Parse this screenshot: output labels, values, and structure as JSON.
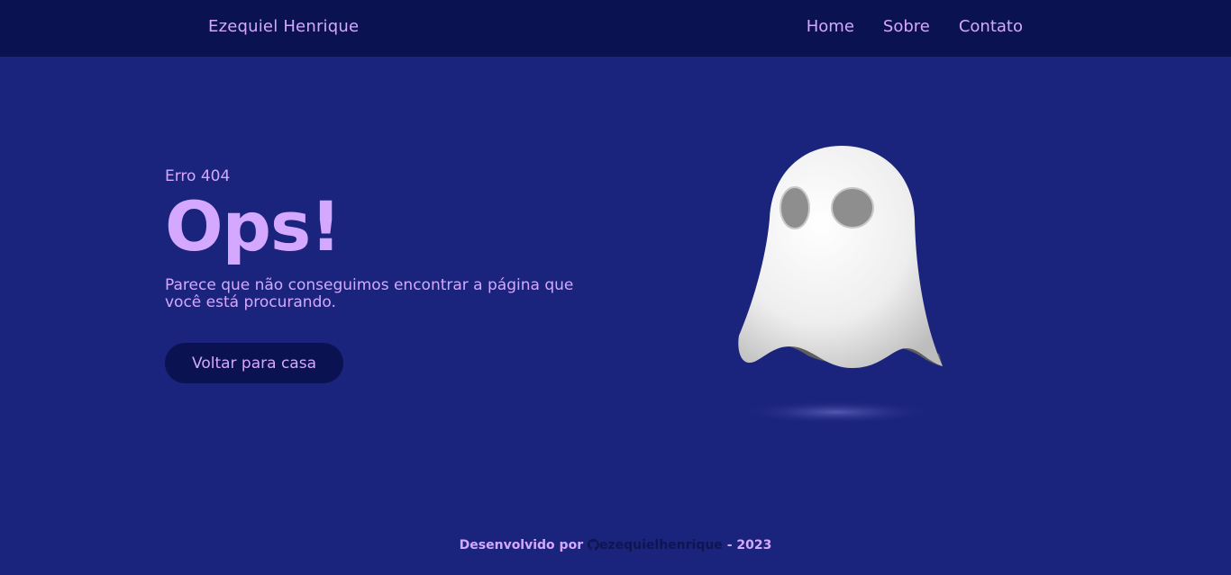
{
  "header": {
    "brand": "Ezequiel Henrique",
    "nav": [
      {
        "label": "Home"
      },
      {
        "label": "Sobre"
      },
      {
        "label": "Contato"
      }
    ]
  },
  "hero": {
    "eyebrow": "Erro 404",
    "title": "Ops!",
    "message": "Parece que não conseguimos encontrar a página que você está procurando.",
    "button_label": "Voltar para casa"
  },
  "illustration": {
    "icon": "ghost-illustration"
  },
  "footer": {
    "prefix": "Desenvolvido por",
    "username": "ezequielhenrique",
    "suffix": "- 2023",
    "icon": "github-icon"
  },
  "colors": {
    "background": "#1b247c",
    "header_bg": "#0b1252",
    "accent": "#d5a8ff"
  }
}
